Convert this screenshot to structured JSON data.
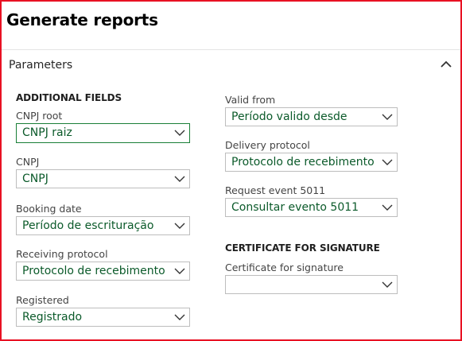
{
  "page": {
    "title": "Generate reports"
  },
  "section": {
    "title": "Parameters"
  },
  "additional_fields": {
    "title": "ADDITIONAL FIELDS",
    "cnpj_root": {
      "label": "CNPJ root",
      "value": "CNPJ raiz"
    },
    "cnpj": {
      "label": "CNPJ",
      "value": "CNPJ"
    },
    "booking_date": {
      "label": "Booking date",
      "value": "Período de escrituração"
    },
    "receiving_protocol": {
      "label": "Receiving protocol",
      "value": "Protocolo de recebimento"
    },
    "registered": {
      "label": "Registered",
      "value": "Registrado"
    },
    "valid_from": {
      "label": "Valid from",
      "value": "Período valido desde"
    },
    "delivery_protocol": {
      "label": "Delivery protocol",
      "value": "Protocolo de recebimento"
    },
    "request_event": {
      "label": "Request event 5011",
      "value": "Consultar evento 5011"
    }
  },
  "certificate": {
    "title": "CERTIFICATE FOR SIGNATURE",
    "field": {
      "label": "Certificate for signature",
      "value": ""
    }
  },
  "icons": {
    "collapse": "chevron-up-icon",
    "dropdown": "chevron-down-icon"
  },
  "colors": {
    "frame_border": "#e81123",
    "value_text": "#0b5a2a",
    "focus_border": "#1a7f37"
  }
}
